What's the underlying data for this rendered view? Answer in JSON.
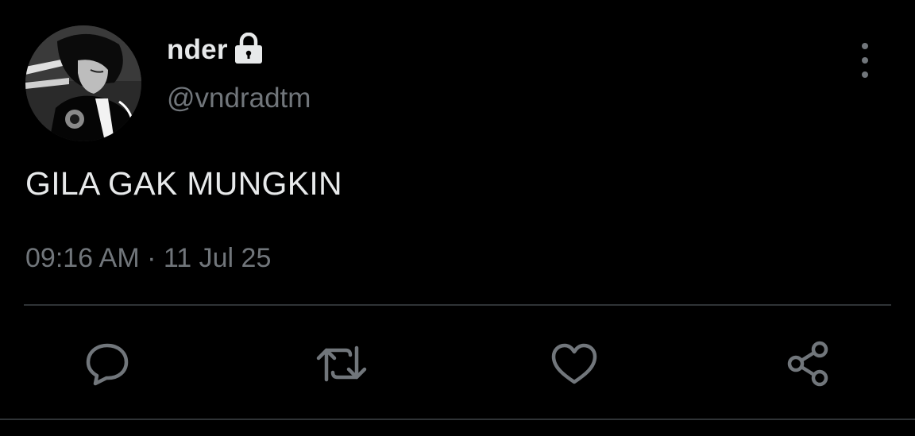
{
  "author": {
    "display_name": "nder",
    "handle": "@vndradtm",
    "avatar_alt": "profile photo"
  },
  "tweet": {
    "text": "GILA GAK MUNGKIN",
    "time": "09:16 AM",
    "separator": "·",
    "date": "11 Jul 25"
  },
  "icons": {
    "lock": "lock-icon",
    "more": "more-vertical-icon",
    "reply": "reply-icon",
    "retweet": "retweet-icon",
    "like": "heart-icon",
    "share": "share-icon"
  },
  "colors": {
    "background": "#000000",
    "text_primary": "#e7e9ea",
    "text_secondary": "#71767b",
    "divider": "#2f3336"
  }
}
